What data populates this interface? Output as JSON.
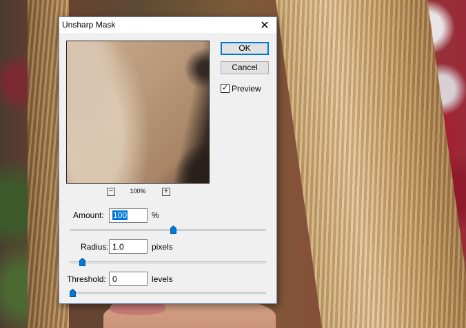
{
  "window": {
    "title": "Unsharp Mask",
    "close_glyph": "✕",
    "close_icon": "close-icon"
  },
  "buttons": {
    "ok_label": "OK",
    "cancel_label": "Cancel"
  },
  "preview": {
    "checkbox_label": "Preview",
    "checked": true,
    "check_glyph": "✓"
  },
  "zoom": {
    "minus_label": "−",
    "plus_label": "+",
    "level": "100%"
  },
  "fields": {
    "amount": {
      "label": "Amount:",
      "value": "100",
      "unit": "%",
      "slider_fraction": 0.53
    },
    "radius": {
      "label": "Radius:",
      "value": "1.0",
      "unit": "pixels",
      "slider_fraction": 0.05
    },
    "threshold": {
      "label": "Threshold:",
      "value": "0",
      "unit": "levels",
      "slider_fraction": 0.0
    }
  },
  "colors": {
    "accent": "#0078d7",
    "dialog_bg": "#f0f0f0"
  }
}
